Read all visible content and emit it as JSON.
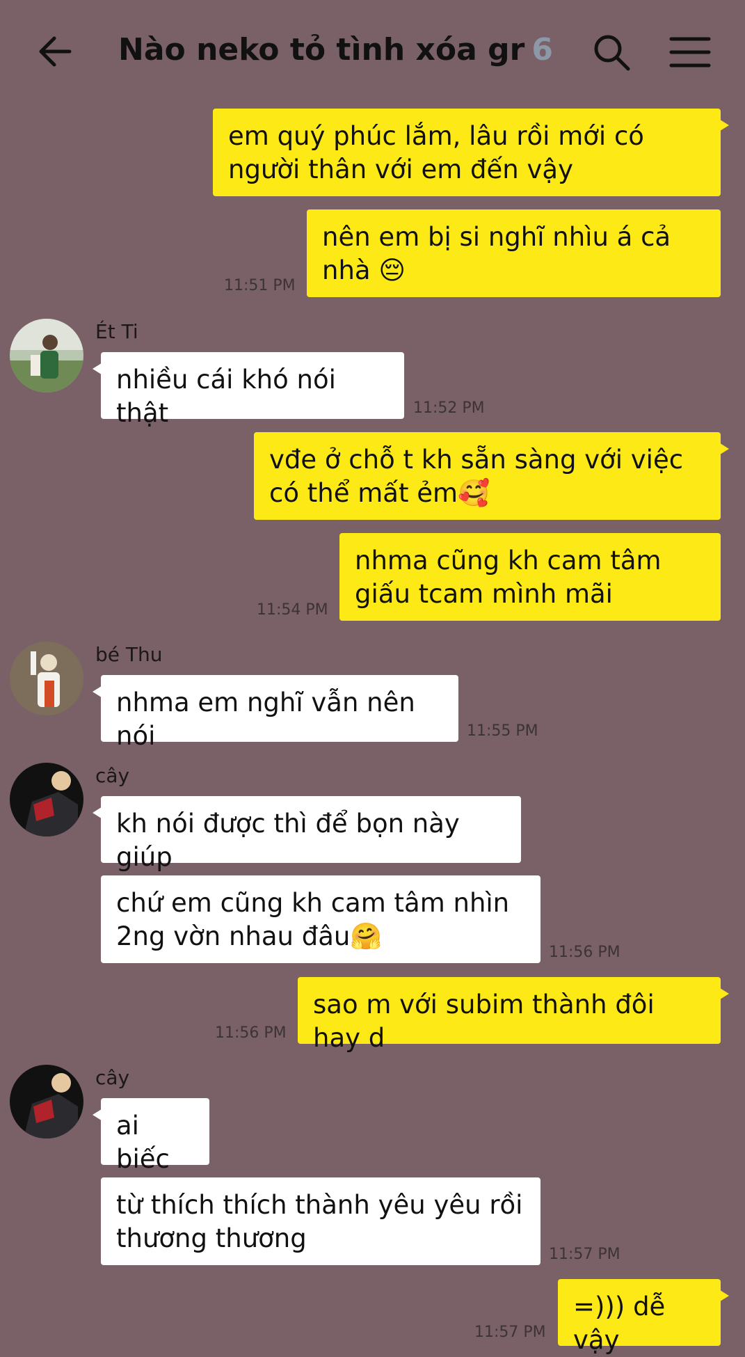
{
  "header": {
    "title": "Nào neko tỏ tình xóa gr",
    "member_count": "6",
    "back_icon": "arrow-left-icon",
    "search_icon": "search-icon",
    "menu_icon": "hamburger-menu-icon"
  },
  "colors": {
    "background": "#7a6167",
    "outgoing_bubble": "#fde915",
    "incoming_bubble": "#ffffff",
    "timestamp": "#3c3336"
  },
  "messages": [
    {
      "dir": "out",
      "text": "em quý phúc lắm, lâu rồi mới có người thân với em đến vậy"
    },
    {
      "dir": "out",
      "text": "nên em bị si nghĩ nhìu á cả nhà 😔",
      "time": "11:51 PM"
    },
    {
      "dir": "in",
      "sender": "Ét Ti",
      "text": "nhiều cái khó nói thật",
      "time": "11:52 PM"
    },
    {
      "dir": "out",
      "text": "vđe ở chỗ t kh sẵn sàng với việc có thể mất ẻm🥰"
    },
    {
      "dir": "out",
      "text": "nhma cũng kh cam tâm giấu tcam mình mãi",
      "time": "11:54 PM"
    },
    {
      "dir": "in",
      "sender": "bé Thu",
      "text": "nhma em nghĩ vẫn nên nói",
      "time": "11:55 PM"
    },
    {
      "dir": "in",
      "sender": "cây",
      "text": "kh nói được thì để bọn này giúp"
    },
    {
      "dir": "in",
      "text": "chứ em cũng kh cam tâm nhìn 2ng vờn nhau đâu🤗",
      "time": "11:56 PM"
    },
    {
      "dir": "out",
      "text": "sao m với subim thành đôi hay d",
      "time": "11:56 PM"
    },
    {
      "dir": "in",
      "sender": "cây",
      "text": "ai biếc"
    },
    {
      "dir": "in",
      "text": "từ thích thích thành yêu yêu rồi thương thương",
      "time": "11:57 PM"
    },
    {
      "dir": "out",
      "text": "=))) dễ vậy",
      "time": "11:57 PM"
    }
  ]
}
